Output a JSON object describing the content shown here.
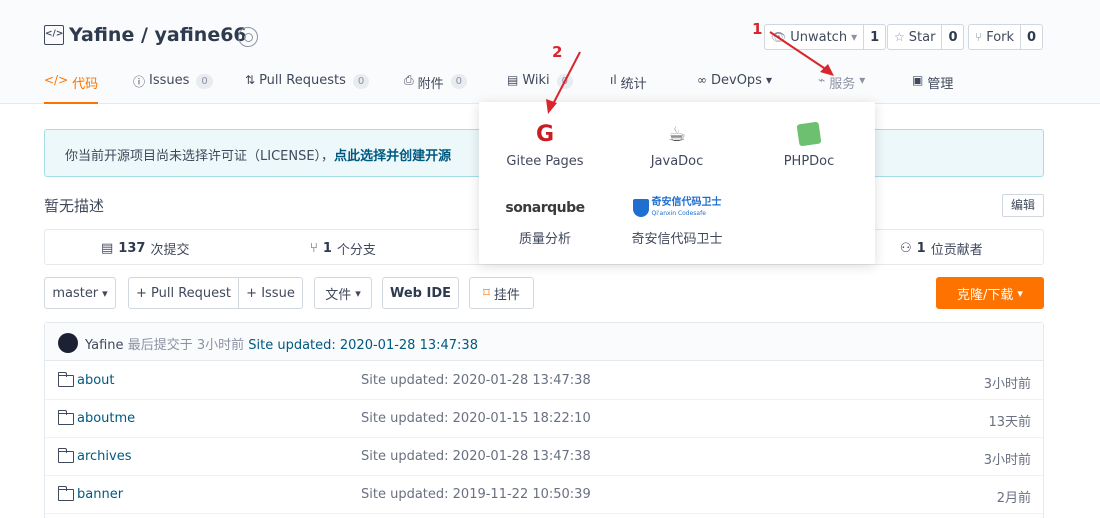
{
  "repo": {
    "title": "Yafine / yafine66",
    "icon": "code-icon",
    "badge_icon": "badge-icon"
  },
  "actions": {
    "unwatch": {
      "label": "Unwatch",
      "count": "1"
    },
    "star": {
      "label": "Star",
      "count": "0"
    },
    "fork": {
      "label": "Fork",
      "count": "0"
    }
  },
  "tabs": [
    {
      "label": "代码",
      "icon": "code-icon"
    },
    {
      "label": "Issues",
      "count": "0",
      "icon": "issue-icon"
    },
    {
      "label": "Pull Requests",
      "count": "0",
      "icon": "pr-icon"
    },
    {
      "label": "附件",
      "count": "0",
      "icon": "attachment-icon"
    },
    {
      "label": "Wiki",
      "count": "0",
      "icon": "wiki-icon"
    },
    {
      "label": "统计",
      "icon": "chart-icon"
    },
    {
      "label": "DevOps",
      "icon": "devops-icon"
    },
    {
      "label": "服务",
      "icon": "service-icon"
    },
    {
      "label": "管理",
      "icon": "manage-icon"
    }
  ],
  "notice": {
    "text": "你当前开源项目尚未选择许可证（LICENSE），",
    "link": "点此选择并创建开源"
  },
  "description": "暂无描述",
  "edit_label": "编辑",
  "stats": {
    "commits": {
      "num": "137",
      "label": "次提交"
    },
    "branches": {
      "num": "1",
      "label": "个分支"
    },
    "contributors": {
      "num": "1",
      "label": "位贡献者"
    }
  },
  "toolbar": {
    "branch": "master",
    "new_pr": "+ Pull Request",
    "new_issue": "+ Issue",
    "files": "文件",
    "webide": "Web IDE",
    "widget": "挂件",
    "clone": "克隆/下载"
  },
  "latest_commit": {
    "author": "Yafine",
    "meta": "最后提交于 3小时前",
    "message": "Site updated: 2020-01-28 13:47:38"
  },
  "files": [
    {
      "name": "about",
      "message": "Site updated: 2020-01-28 13:47:38",
      "time": "3小时前"
    },
    {
      "name": "aboutme",
      "message": "Site updated: 2020-01-15 18:22:10",
      "time": "13天前"
    },
    {
      "name": "archives",
      "message": "Site updated: 2020-01-28 13:47:38",
      "time": "3小时前"
    },
    {
      "name": "banner",
      "message": "Site updated: 2019-11-22 10:50:39",
      "time": "2月前"
    }
  ],
  "services": [
    {
      "label": "Gitee Pages",
      "icon": "gitee-pages-icon"
    },
    {
      "label": "JavaDoc",
      "icon": "javadoc-icon"
    },
    {
      "label": "PHPDoc",
      "icon": "phpdoc-icon"
    },
    {
      "label": "质量分析",
      "icon": "sonarqube-icon",
      "logo_text": "sonarqube"
    },
    {
      "label": "奇安信代码卫士",
      "icon": "qianxin-icon",
      "logo_text": "奇安信代码卫士",
      "logo_sub": "Qi'anxin Codesafe"
    }
  ],
  "annotations": {
    "one": "1",
    "two": "2",
    "color": "#d9262c"
  },
  "colors": {
    "accent": "#fe7300",
    "link": "#005980"
  }
}
